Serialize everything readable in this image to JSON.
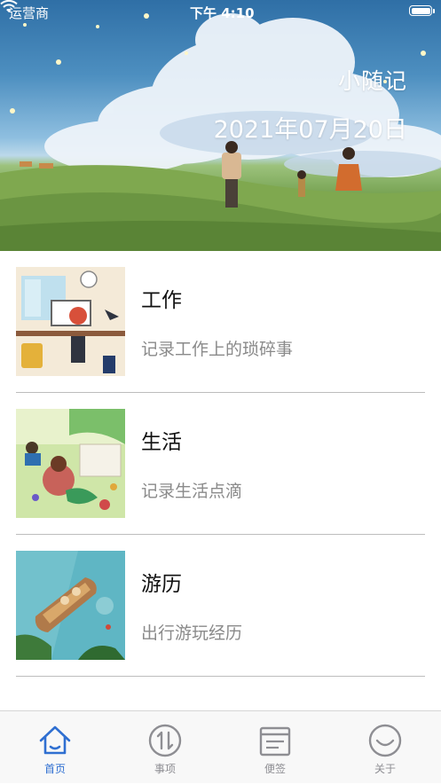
{
  "status_bar": {
    "carrier": "运营商",
    "time": "下午 4:10"
  },
  "header": {
    "app_title": "小随记",
    "date": "2021年07月20日"
  },
  "categories": [
    {
      "title": "工作",
      "description": "记录工作上的琐碎事",
      "icon": "office-illustration"
    },
    {
      "title": "生活",
      "description": "记录生活点滴",
      "icon": "family-picnic-illustration"
    },
    {
      "title": "游历",
      "description": "出行游玩经历",
      "icon": "boat-travel-illustration"
    }
  ],
  "tabbar": {
    "items": [
      {
        "label": "首页",
        "icon": "home-icon",
        "active": true
      },
      {
        "label": "事项",
        "icon": "transfer-arrows-icon",
        "active": false
      },
      {
        "label": "便签",
        "icon": "notepad-icon",
        "active": false
      },
      {
        "label": "关于",
        "icon": "smile-icon",
        "active": false
      }
    ],
    "active_color": "#2f6fd1",
    "inactive_color": "#8e8e93"
  }
}
